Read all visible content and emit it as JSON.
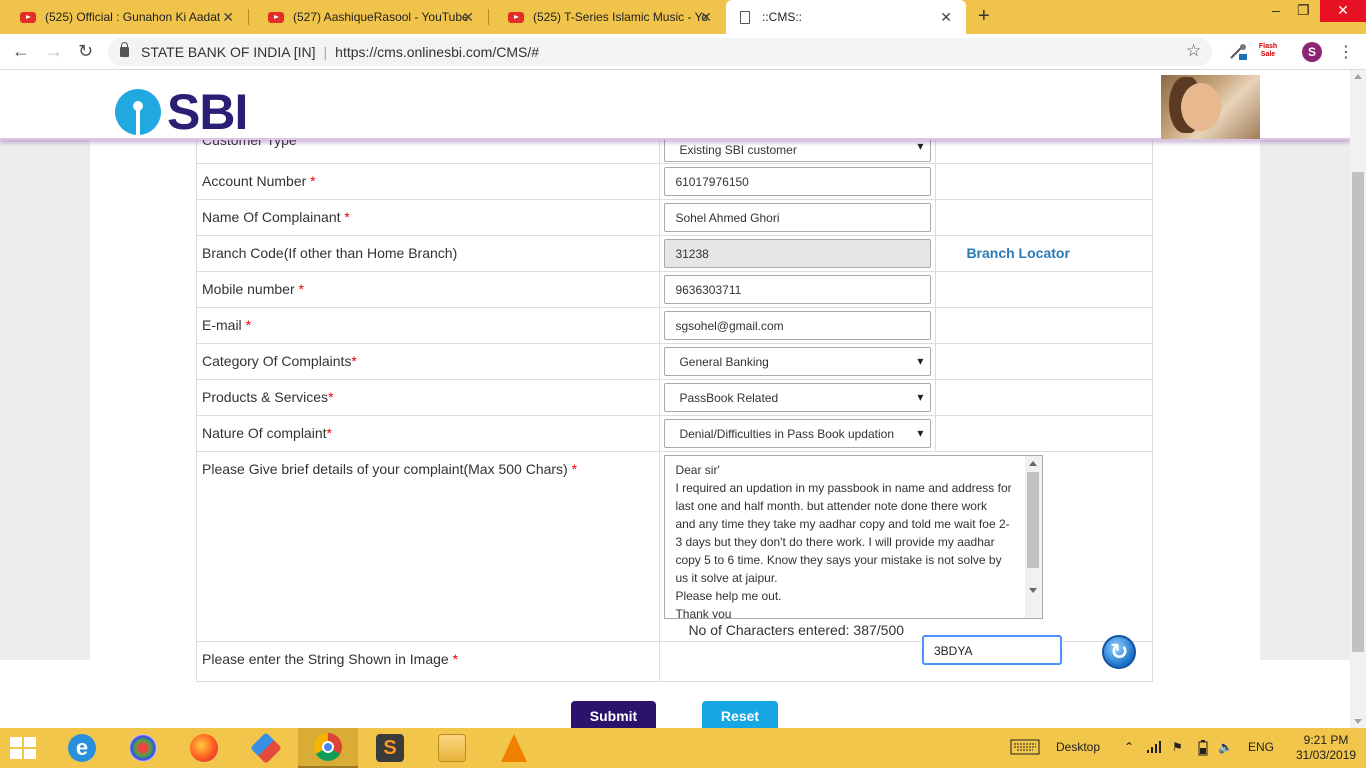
{
  "browser": {
    "tabs": [
      {
        "title": "(525) Official : Gunahon Ki Aadat"
      },
      {
        "title": "(527) AashiqueRasool - YouTube"
      },
      {
        "title": "(525) T-Series Islamic Music - You"
      },
      {
        "title": "::CMS::"
      }
    ],
    "site_org": "STATE BANK OF INDIA [IN]",
    "url": "https://cms.onlinesbi.com/CMS/#",
    "profile_initial": "S",
    "flash_sale": "Flash Sale"
  },
  "header": {
    "logo_text": "SBI"
  },
  "form": {
    "customer_type": {
      "label": "Customer Type",
      "value": "Existing SBI customer"
    },
    "account_number": {
      "label": "Account Number",
      "value": "61017976150"
    },
    "name": {
      "label": "Name Of Complainant",
      "value": "Sohel Ahmed Ghori"
    },
    "branch_code": {
      "label": "Branch Code(If other than Home Branch)",
      "value": "31238",
      "link": "Branch Locator"
    },
    "mobile": {
      "label": "Mobile number",
      "value": "9636303711"
    },
    "email": {
      "label": "E-mail",
      "value": "sgsohel@gmail.com"
    },
    "category": {
      "label": "Category Of Complaints",
      "value": "General Banking"
    },
    "products": {
      "label": "Products & Services",
      "value": "PassBook Related"
    },
    "nature": {
      "label": "Nature Of complaint",
      "value": "Denial/Difficulties in Pass Book updation"
    },
    "details": {
      "label": "Please Give brief details of your complaint(Max 500 Chars)",
      "lines": [
        "Dear sir'",
        "I required an updation in my passbook in name and address for",
        "last one and half month. but attender note done there work",
        "and any time they take my aadhar copy and told me wait foe 2-",
        "3 days but they don't do there work. I will provide my aadhar",
        "copy 5 to 6 time. Know they says your mistake is not solve by",
        "us it solve at jaipur.",
        "Please help me out.",
        "Thank you"
      ],
      "counter": "No of Characters entered: 387/500"
    },
    "captcha": {
      "label": "Please enter the String Shown in Image",
      "value": "3BDYA"
    },
    "required_mark": "*",
    "submit": "Submit",
    "reset": "Reset"
  },
  "taskbar": {
    "desktop_label": "Desktop",
    "lang": "ENG",
    "time": "9:21 PM",
    "date": "31/03/2019"
  }
}
